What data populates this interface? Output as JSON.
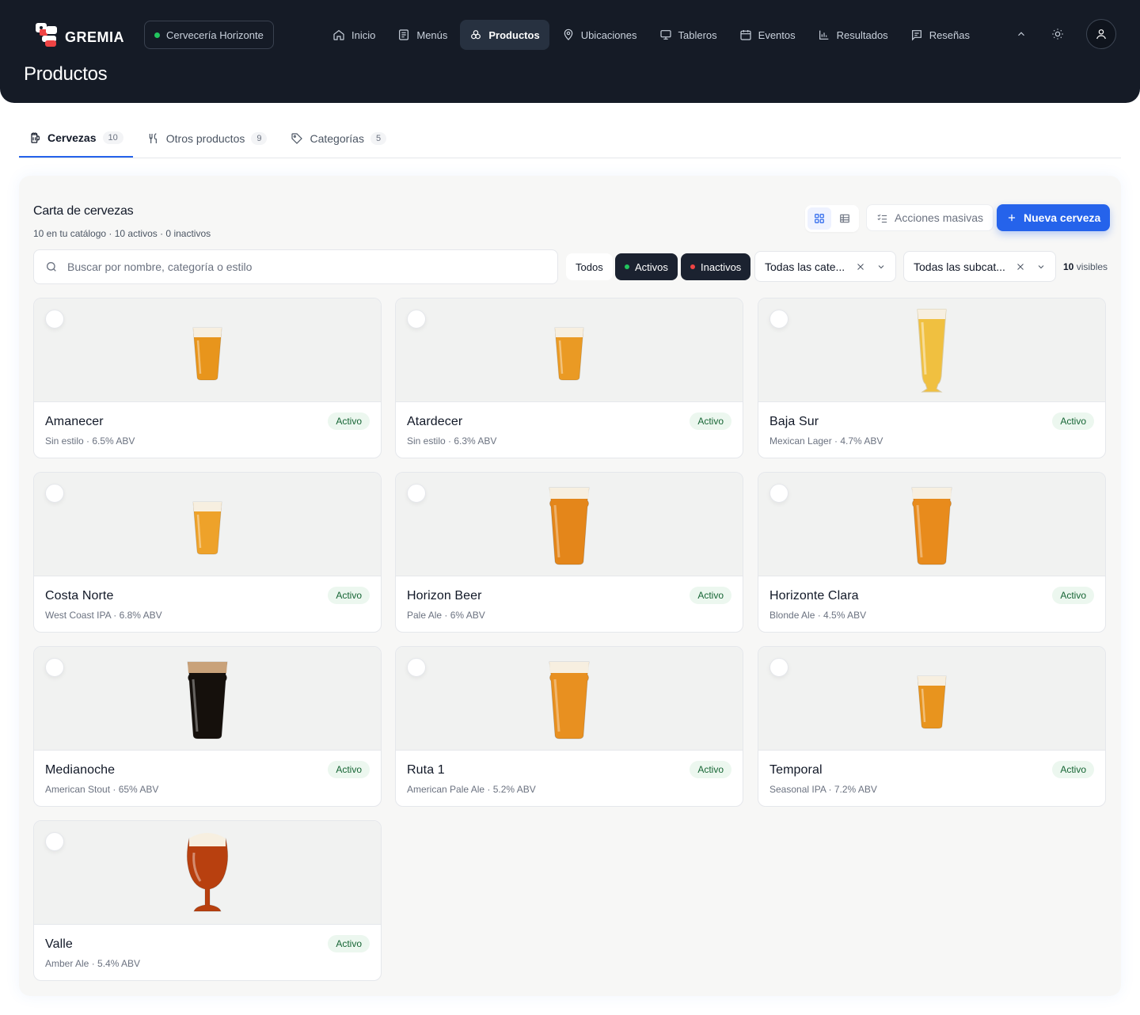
{
  "header": {
    "brand": "GREMIA",
    "venue": "Cervecería Horizonte",
    "nav": [
      {
        "label": "Inicio",
        "icon": "home-icon"
      },
      {
        "label": "Menús",
        "icon": "menu-icon"
      },
      {
        "label": "Productos",
        "icon": "products-icon",
        "active": true
      },
      {
        "label": "Ubicaciones",
        "icon": "location-icon"
      },
      {
        "label": "Tableros",
        "icon": "monitor-icon"
      },
      {
        "label": "Eventos",
        "icon": "calendar-icon"
      },
      {
        "label": "Resultados",
        "icon": "chart-icon"
      },
      {
        "label": "Reseñas",
        "icon": "review-icon"
      }
    ],
    "page_title": "Productos"
  },
  "tabs": [
    {
      "label": "Cervezas",
      "count": "10",
      "icon": "beer-icon",
      "active": true
    },
    {
      "label": "Otros productos",
      "count": "9",
      "icon": "utensils-icon"
    },
    {
      "label": "Categorías",
      "count": "5",
      "icon": "tag-icon"
    }
  ],
  "catalog": {
    "title": "Carta de cervezas",
    "subtitle": "10 en tu catálogo · 10 activos · 0 inactivos",
    "bulk_actions": "Acciones masivas",
    "new_button": "Nueva cerveza",
    "search_placeholder": "Buscar por nombre, categoría o estilo",
    "filters": {
      "all": "Todos",
      "active": "Activos",
      "inactive": "Inactivos"
    },
    "category_select": "Todas las cate...",
    "subcategory_select": "Todas las subcat...",
    "visible_count": "10",
    "visible_label": "visibles"
  },
  "colors": {
    "accent": "#2563eb",
    "header_bg": "#151b26",
    "active_dot": "#22c55e",
    "inactive_dot": "#ef4444"
  },
  "beers": [
    {
      "name": "Amanecer",
      "meta": "Sin estilo · 6.5% ABV",
      "status": "Activo",
      "glass": "shaker-small",
      "beer_color": "#e8951c"
    },
    {
      "name": "Atardecer",
      "meta": "Sin estilo · 6.3% ABV",
      "status": "Activo",
      "glass": "shaker-small",
      "beer_color": "#ea9a24"
    },
    {
      "name": "Baja Sur",
      "meta": "Mexican Lager · 4.7% ABV",
      "status": "Activo",
      "glass": "pilsner",
      "beer_color": "#f0c040"
    },
    {
      "name": "Costa Norte",
      "meta": "West Coast IPA · 6.8% ABV",
      "status": "Activo",
      "glass": "shaker-small",
      "beer_color": "#eea22a"
    },
    {
      "name": "Horizon Beer",
      "meta": "Pale Ale · 6% ABV",
      "status": "Activo",
      "glass": "nonic",
      "beer_color": "#e4861a"
    },
    {
      "name": "Horizonte Clara",
      "meta": "Blonde Ale · 4.5% ABV",
      "status": "Activo",
      "glass": "nonic",
      "beer_color": "#e88b1c"
    },
    {
      "name": "Medianoche",
      "meta": "American Stout · 65% ABV",
      "status": "Activo",
      "glass": "nonic-dark",
      "beer_color": "#15100c"
    },
    {
      "name": "Ruta 1",
      "meta": "American Pale Ale · 5.2% ABV",
      "status": "Activo",
      "glass": "nonic",
      "beer_color": "#e89020"
    },
    {
      "name": "Temporal",
      "meta": "Seasonal IPA · 7.2% ABV",
      "status": "Activo",
      "glass": "shaker-small",
      "beer_color": "#e8941e"
    },
    {
      "name": "Valle",
      "meta": "Amber Ale · 5.4% ABV",
      "status": "Activo",
      "glass": "tulip",
      "beer_color": "#b8400f"
    }
  ]
}
